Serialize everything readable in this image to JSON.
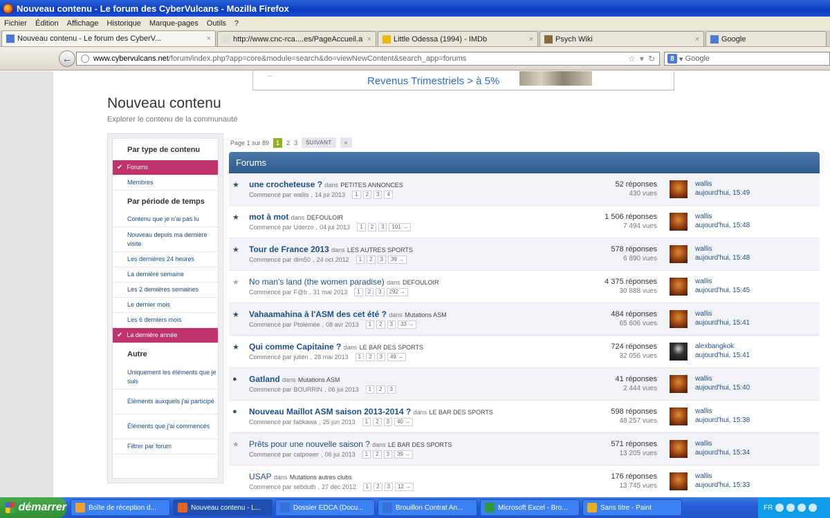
{
  "window": {
    "title": "Nouveau contenu - Le forum des CyberVulcans - Mozilla Firefox"
  },
  "menu": [
    "Fichier",
    "Édition",
    "Affichage",
    "Historique",
    "Marque-pages",
    "Outils",
    "?"
  ],
  "tabs": [
    {
      "label": "Nouveau contenu - Le forum des CyberV...",
      "width": 310,
      "active": true
    },
    {
      "label": "http://www.cnc-rca....es/PageAccueil.aspx",
      "width": 230,
      "active": false
    },
    {
      "label": "Little Odessa (1994) - IMDb",
      "width": 232,
      "active": false
    },
    {
      "label": "Psych Wiki",
      "width": 238,
      "active": false
    },
    {
      "label": "Google",
      "width": 175,
      "active": false
    }
  ],
  "nav": {
    "url_domain": "www.cybervulcans.net",
    "url_path": "/forum/index.php?app=core&module=search&do=viewNewContent&search_app=forums",
    "search_placeholder": "Google"
  },
  "ad": {
    "text": "Revenus Trimestriels > à 5%"
  },
  "page": {
    "title": "Nouveau contenu",
    "subtitle": "Explorer le contenu de la communauté"
  },
  "sidebar": {
    "sections": [
      {
        "heading": "Par type de contenu",
        "items": [
          {
            "label": "Forums",
            "active": true,
            "h": 22
          },
          {
            "label": "Membres",
            "active": false,
            "h": 22
          }
        ]
      },
      {
        "heading": "Par période de temps",
        "items": [
          {
            "label": "Contenu que je n'ai pas lu",
            "active": false,
            "h": 22
          },
          {
            "label": "Nouveau depuis ma dernière visite",
            "active": false,
            "h": 36
          },
          {
            "label": "Les dernières 24 heures",
            "active": false,
            "h": 22
          },
          {
            "label": "La dernière semaine",
            "active": false,
            "h": 22
          },
          {
            "label": "Les 2 dernières semaines",
            "active": false,
            "h": 22
          },
          {
            "label": "Le dernier mois",
            "active": false,
            "h": 22
          },
          {
            "label": "Les 6 derniers mois",
            "active": false,
            "h": 22
          },
          {
            "label": "La dernière année",
            "active": true,
            "h": 22
          }
        ]
      },
      {
        "heading": "Autre",
        "items": [
          {
            "label": "Uniquement les éléments que je suis",
            "active": false,
            "h": 36
          },
          {
            "label": "Éléments auxquels j'ai participé",
            "active": false,
            "h": 36
          },
          {
            "label": "Éléments que j'ai commencés",
            "active": false,
            "h": 36
          },
          {
            "label": "Filtrer par forum",
            "active": false,
            "h": 22
          }
        ]
      }
    ]
  },
  "pagination": {
    "summary": "Page 1 sur 89",
    "current": "1",
    "pages": [
      "2",
      "3"
    ],
    "next": "SUIVANT",
    "last": "»"
  },
  "forum": {
    "header": "Forums",
    "dans": "dans",
    "started_prefix": "Commencé par",
    "rows": [
      {
        "marker": "star",
        "bold": true,
        "title": "une crocheteuse ?",
        "forum": "PETITES ANNONCES",
        "author": "wallis",
        "date": "14 jui 2013",
        "pages": [
          "1",
          "2",
          "3",
          "4"
        ],
        "replies": "52 réponses",
        "views": "430 vues",
        "last_user": "wallis",
        "last_time": "aujourd'hui, 15:49",
        "avatar": "orange"
      },
      {
        "marker": "star",
        "bold": true,
        "title": "mot à mot",
        "forum": "DEFOULOIR",
        "author": "Uderzo",
        "date": "04 jui 2013",
        "pages": [
          "1",
          "2",
          "3",
          "101 →"
        ],
        "replies": "1 506 réponses",
        "views": "7 494 vues",
        "last_user": "wallis",
        "last_time": "aujourd'hui, 15:48",
        "avatar": "orange"
      },
      {
        "marker": "star",
        "bold": true,
        "title": "Tour de France 2013",
        "forum": "LES AUTRES SPORTS",
        "author": "dim50",
        "date": "24 oct 2012",
        "pages": [
          "1",
          "2",
          "3",
          "39 →"
        ],
        "replies": "578 réponses",
        "views": "6 890 vues",
        "last_user": "wallis",
        "last_time": "aujourd'hui, 15:48",
        "avatar": "orange"
      },
      {
        "marker": "star-off",
        "bold": false,
        "title": "No man's land (the women paradise)",
        "forum": "DEFOULOIR",
        "author": "F@b",
        "date": "31 mai 2013",
        "pages": [
          "1",
          "2",
          "3",
          "292 →"
        ],
        "replies": "4 375 réponses",
        "views": "30 888 vues",
        "last_user": "wallis",
        "last_time": "aujourd'hui, 15:45",
        "avatar": "orange"
      },
      {
        "marker": "star",
        "bold": true,
        "title": "Vahaamahina à l'ASM des cet été ?",
        "forum": "Mutations ASM",
        "author": "Ptolémée",
        "date": "08 avr 2013",
        "pages": [
          "1",
          "2",
          "3",
          "33 →"
        ],
        "replies": "484 réponses",
        "views": "65 606 vues",
        "last_user": "wallis",
        "last_time": "aujourd'hui, 15:41",
        "avatar": "orange"
      },
      {
        "marker": "star",
        "bold": true,
        "title": "Qui comme Capitaine ?",
        "forum": "LE BAR DES SPORTS",
        "author": "julien",
        "date": "28 mai 2013",
        "pages": [
          "1",
          "2",
          "3",
          "49 →"
        ],
        "replies": "724 réponses",
        "views": "32 056 vues",
        "last_user": "alexbangkok",
        "last_time": "aujourd'hui, 15:41",
        "avatar": "dark"
      },
      {
        "marker": "dot",
        "bold": true,
        "title": "Gatland",
        "forum": "Mutations ASM",
        "author": "BOURRIN",
        "date": "06 jui 2013",
        "pages": [
          "1",
          "2",
          "3"
        ],
        "replies": "41 réponses",
        "views": "2 444 vues",
        "last_user": "wallis",
        "last_time": "aujourd'hui, 15:40",
        "avatar": "orange"
      },
      {
        "marker": "dot",
        "bold": true,
        "title": "Nouveau Maillot ASM saison 2013-2014 ?",
        "forum": "LE BAR DES SPORTS",
        "author": "fabkawa",
        "date": "25 jun 2013",
        "pages": [
          "1",
          "2",
          "3",
          "40 →"
        ],
        "replies": "598 réponses",
        "views": "48 257 vues",
        "last_user": "wallis",
        "last_time": "aujourd'hui, 15:38",
        "avatar": "orange"
      },
      {
        "marker": "star-off",
        "bold": false,
        "title": "Prêts pour une nouvelle saison ?",
        "forum": "LE BAR DES SPORTS",
        "author": "catpower",
        "date": "06 jui 2013",
        "pages": [
          "1",
          "2",
          "3",
          "39 →"
        ],
        "replies": "571 réponses",
        "views": "13 205 vues",
        "last_user": "wallis",
        "last_time": "aujourd'hui, 15:34",
        "avatar": "orange"
      },
      {
        "marker": "none",
        "bold": false,
        "title": "USAP",
        "forum": "Mutations autres clubs",
        "author": "sebduth",
        "date": "27 déc 2012",
        "pages": [
          "1",
          "2",
          "3",
          "12 →"
        ],
        "replies": "176 réponses",
        "views": "13 745 vues",
        "last_user": "wallis",
        "last_time": "aujourd'hui, 15:33",
        "avatar": "orange"
      }
    ]
  },
  "taskbar": {
    "start": "démarrer",
    "tasks": [
      {
        "label": "Boîte de réception d...",
        "active": false
      },
      {
        "label": "Nouveau contenu - L...",
        "active": true
      },
      {
        "label": "Dossier EDCA (Docu...",
        "active": false
      },
      {
        "label": "Brouillon Contrat An...",
        "active": false
      },
      {
        "label": "Microsoft Excel - Bro...",
        "active": false
      },
      {
        "label": "Sans titre - Paint",
        "active": false
      }
    ],
    "lang": "FR"
  }
}
